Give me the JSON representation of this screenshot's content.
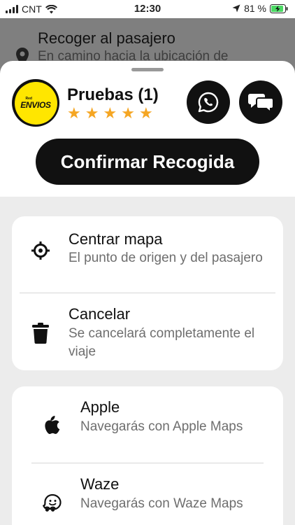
{
  "status_bar": {
    "carrier": "CNT",
    "time": "12:30",
    "battery": "81 %"
  },
  "background": {
    "title": "Recoger al pasajero",
    "subtitle": "En camino hacia la ubicación de"
  },
  "driver_card": {
    "logo_small": "Red",
    "logo_text": "ENVIOS",
    "name": "Pruebas (1)",
    "rating_stars": 5,
    "confirm_label": "Confirmar Recogida"
  },
  "actions": [
    {
      "title": "Centrar mapa",
      "subtitle": "El punto de origen y del pasajero",
      "icon": "crosshair-icon"
    },
    {
      "title": "Cancelar",
      "subtitle": "Se cancelará completamente el viaje",
      "icon": "trash-icon"
    }
  ],
  "navigation": [
    {
      "title": "Apple",
      "subtitle": "Navegarás con Apple Maps",
      "icon": "apple-icon"
    },
    {
      "title": "Waze",
      "subtitle": "Navegarás con Waze Maps",
      "icon": "waze-icon"
    }
  ],
  "colors": {
    "accent_star": "#f5a623",
    "logo_yellow": "#ffe600",
    "battery_green": "#4cd964"
  }
}
